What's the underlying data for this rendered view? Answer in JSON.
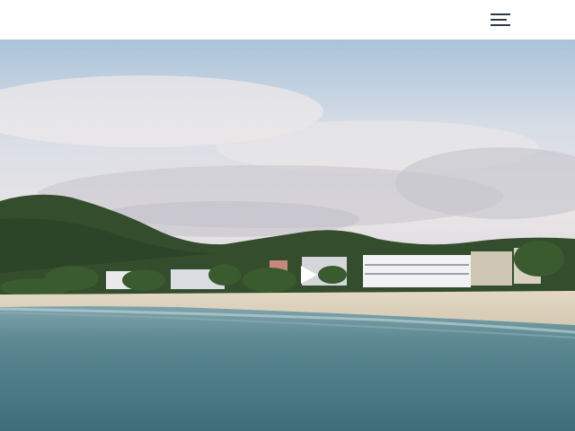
{
  "header": {
    "menu_icon": "hamburger-menu-icon",
    "background": "#ffffff",
    "icon_color": "#2b3a4a"
  },
  "video": {
    "play_icon": "play-icon",
    "play_color": "#ffffff",
    "colors": {
      "sky_top": "#b9cde0",
      "sky_mid": "#e7e4e4",
      "hill": "#2f4a2b",
      "sand": "#dcd2c0",
      "water": "#4f7e88"
    }
  }
}
